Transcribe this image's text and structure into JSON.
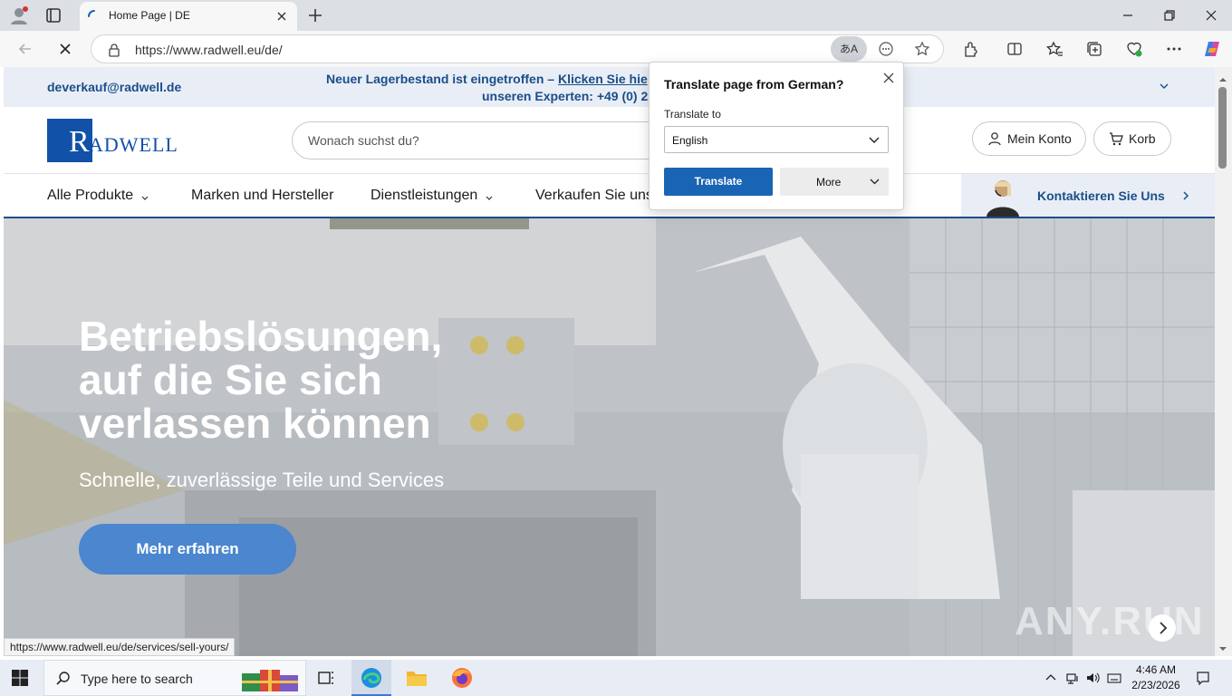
{
  "browser": {
    "tab_title": "Home Page | DE",
    "url": "https://www.radwell.eu/de/",
    "translate_indicator": "あA",
    "status_url": "https://www.radwell.eu/de/services/sell-yours/"
  },
  "page": {
    "top_strip": {
      "email": "deverkauf@radwell.de",
      "promo_text": "Neuer Lagerbestand ist eingetroffen –",
      "promo_link": "Klicken Sie hie",
      "promo_line2": "unseren Experten:  +49 (0) 2"
    },
    "header": {
      "logo_text": "RADWELL",
      "search_placeholder": "Wonach suchst du?",
      "account_label": "Mein Konto",
      "cart_label": "Korb"
    },
    "nav": {
      "items": [
        "Alle Produkte",
        "Marken und Hersteller",
        "Dienstleistungen",
        "Verkaufen Sie uns"
      ],
      "contact_label": "Kontaktieren Sie Uns"
    },
    "hero": {
      "headline_1": "Betriebslösungen,",
      "headline_2": "auf die Sie sich",
      "headline_3": "verlassen können",
      "subline": "Schnelle, zuverlässige Teile und Services",
      "cta": "Mehr erfahren",
      "watermark": "ANY.RUN"
    }
  },
  "translate_popup": {
    "title": "Translate page from German?",
    "target_label": "Translate to",
    "target_value": "English",
    "translate_button": "Translate",
    "more_button": "More"
  },
  "taskbar": {
    "search_placeholder": "Type here to search",
    "time": "4:46 AM",
    "date": "2/23/2026"
  },
  "colors": {
    "brand_blue": "#1a4e8a",
    "logo_blue": "#1251a8",
    "cta_blue": "#4b86cf",
    "translate_blue": "#1a64b4",
    "strip_bg": "#e9eef6"
  }
}
